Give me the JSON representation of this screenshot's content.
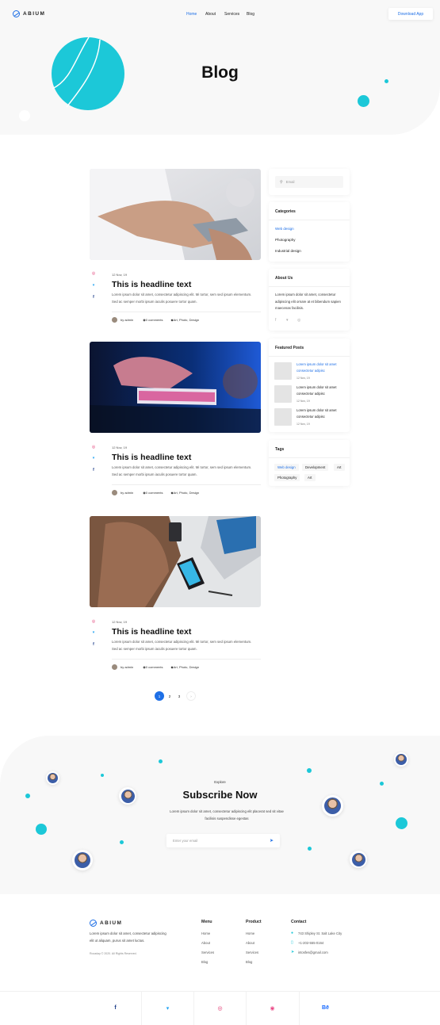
{
  "header": {
    "brand": "ABIUM",
    "nav": [
      {
        "label": "Home",
        "active": true
      },
      {
        "label": "About"
      },
      {
        "label": "Services"
      },
      {
        "label": "Blog"
      }
    ],
    "cta": "Download App",
    "title": "Blog"
  },
  "colors": {
    "accent": "#1e6fe6",
    "teal": "#1cc8d8",
    "light_bg": "#f8f8f8"
  },
  "posts": [
    {
      "date": "12 Nov, 19",
      "title": "This is headline text",
      "excerpt": "Lorem ipsum dolor sit amet, consectetur adipiscing elit. Mi tortor, sem sed ipsum elementum. Sed ac semper morbi ipsum iaculis posuere tortor quam.",
      "author": "by admin",
      "comments": "0 comments",
      "tags": "Art, Photo, Design"
    },
    {
      "date": "12 Nov, 19",
      "title": "This is headline text",
      "excerpt": "Lorem ipsum dolor sit amet, consectetur adipiscing elit. Mi tortor, sem sed ipsum elementum. Sed ac semper morbi ipsum iaculis posuere tortor quam.",
      "author": "by admin",
      "comments": "0 comments",
      "tags": "Art, Photo, Design"
    },
    {
      "date": "12 Nov, 19",
      "title": "This is headline text",
      "excerpt": "Lorem ipsum dolor sit amet, consectetur adipiscing elit. Mi tortor, sem sed ipsum elementum. Sed ac semper morbi ipsum iaculis posuere tortor quam.",
      "author": "by admin",
      "comments": "0 comments",
      "tags": "Art, Photo, Design"
    }
  ],
  "sidebar": {
    "search_placeholder": "Email",
    "categories": {
      "title": "Categories",
      "items": [
        "Web design",
        "Photography",
        "Industrial design"
      ]
    },
    "about": {
      "title": "About Us",
      "text": "Lorem ipsum dolor sit amet, consectetur adipiscing elit ornare at et bibendum sapien maecenas facilisis."
    },
    "featured": {
      "title": "Featured Posts",
      "items": [
        {
          "title": "Lorem ipsum dolor sit amet consectetur adipisc",
          "date": "12 Nov, 19"
        },
        {
          "title": "Lorem ipsum dolor sit amet consectetur adipisc",
          "date": "12 Nov, 19"
        },
        {
          "title": "Lorem ipsum dolor sit amet consectetur adipisc",
          "date": "12 Nov, 19"
        }
      ]
    },
    "tags": {
      "title": "Tags",
      "items": [
        "Web design",
        "Development",
        "Art",
        "Photography",
        "Art"
      ]
    }
  },
  "pagination": {
    "pages": [
      "1",
      "2",
      "3"
    ],
    "current": "1",
    "next": "›"
  },
  "subscribe": {
    "eyebrow": "Explore",
    "title": "Subscribe Now",
    "text": "Lorem ipsum dolor sit amet, consectetur adipiscing elit placerat sed sit vitae facilisis suspendisse egestas",
    "placeholder": "Enter your email"
  },
  "footer": {
    "brand": "ABIUM",
    "desc": "Lorem ipsum dolor sit amet, consectetur adipiscing elit ut aliquam, purus sit amet luctus.",
    "copyright": "Rocaday © 2020. All Rights Reserved.",
    "menu": {
      "title": "Menu",
      "items": [
        "Home",
        "About",
        "Services",
        "Blog"
      ]
    },
    "product": {
      "title": "Product",
      "items": [
        "Home",
        "About",
        "Services",
        "Blog"
      ]
    },
    "contact": {
      "title": "Contact",
      "items": [
        "743 Shipley St. Salt Lake City",
        "+1-202-555-0164",
        "intosfes@gmail.com"
      ]
    }
  },
  "social_bar": [
    {
      "icon": "facebook-icon",
      "glyph": "f",
      "color": "#1e3f8a"
    },
    {
      "icon": "twitter-icon",
      "glyph": "🐦",
      "color": "#1da1f2"
    },
    {
      "icon": "instagram-icon",
      "glyph": "◎",
      "color": "#e1306c"
    },
    {
      "icon": "dribbble-icon",
      "glyph": "◉",
      "color": "#ea4c89"
    },
    {
      "icon": "behance-icon",
      "glyph": "Bē",
      "color": "#1769ff"
    }
  ]
}
